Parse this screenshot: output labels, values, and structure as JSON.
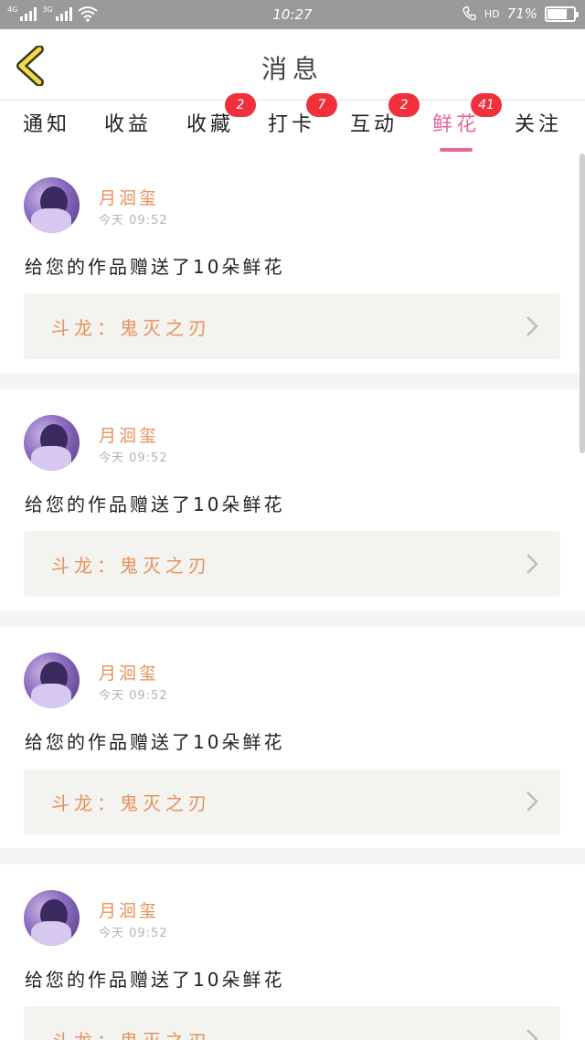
{
  "status_bar": {
    "net1": "4G",
    "net2": "3G",
    "time": "10:27",
    "hd": "HD",
    "battery_text": "71%",
    "battery_level": 0.71
  },
  "header": {
    "title": "消息"
  },
  "tabs": [
    {
      "label": "通知",
      "badge": ""
    },
    {
      "label": "收益",
      "badge": ""
    },
    {
      "label": "收藏",
      "badge": "2"
    },
    {
      "label": "打卡",
      "badge": "7"
    },
    {
      "label": "互动",
      "badge": "2"
    },
    {
      "label": "鲜花",
      "badge": "41",
      "active": true
    },
    {
      "label": "关注",
      "badge": ""
    }
  ],
  "messages": [
    {
      "user": "月洄玺",
      "time": "今天 09:52",
      "text": "给您的作品赠送了10朵鲜花",
      "work": "斗龙：鬼灭之刃"
    },
    {
      "user": "月洄玺",
      "time": "今天 09:52",
      "text": "给您的作品赠送了10朵鲜花",
      "work": "斗龙：鬼灭之刃"
    },
    {
      "user": "月洄玺",
      "time": "今天 09:52",
      "text": "给您的作品赠送了10朵鲜花",
      "work": "斗龙：鬼灭之刃"
    },
    {
      "user": "月洄玺",
      "time": "今天 09:52",
      "text": "给您的作品赠送了10朵鲜花",
      "work": "斗龙：鬼灭之刃"
    }
  ],
  "colors": {
    "accent": "#e8679a",
    "badge": "#f0303a",
    "orange_text": "#e8915c",
    "back_arrow": "#f4d94a"
  },
  "icons": {
    "back": "chevron-left-icon",
    "link": "chevron-right-icon",
    "wifi": "wifi-icon",
    "phone": "phone-icon",
    "battery": "battery-icon"
  }
}
